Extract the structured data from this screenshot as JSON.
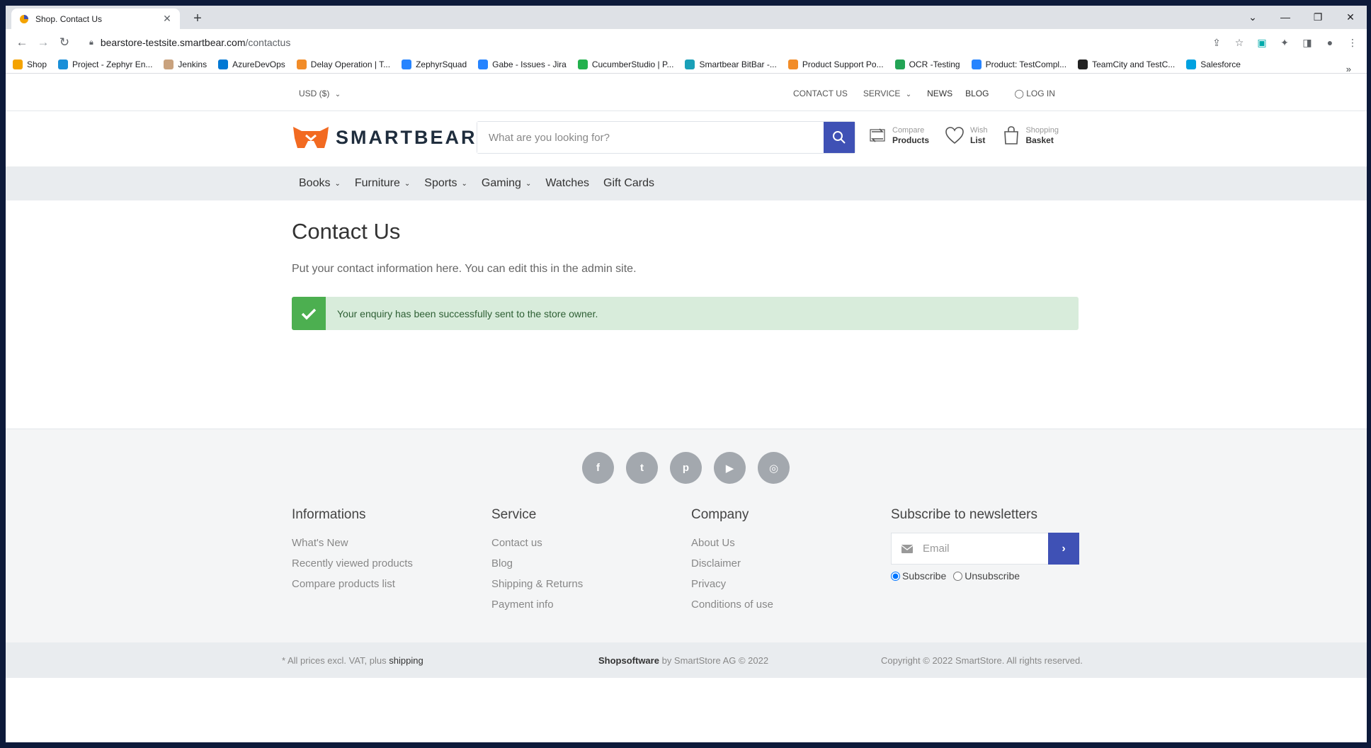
{
  "browser": {
    "tab_title": "Shop. Contact Us",
    "tab_close": "✕",
    "new_tab": "+",
    "url_host": "bearstore-testsite.smartbear.com",
    "url_path": "/contactus",
    "bookmarks": [
      {
        "label": "Shop",
        "color": "#f4a300"
      },
      {
        "label": "Project - Zephyr En...",
        "color": "#1a8fd8"
      },
      {
        "label": "Jenkins",
        "color": "#c9a27e"
      },
      {
        "label": "AzureDevOps",
        "color": "#0078d4"
      },
      {
        "label": "Delay Operation | T...",
        "color": "#f28c28"
      },
      {
        "label": "ZephyrSquad",
        "color": "#2684ff"
      },
      {
        "label": "Gabe - Issues - Jira",
        "color": "#2684ff"
      },
      {
        "label": "CucumberStudio | P...",
        "color": "#23b14d"
      },
      {
        "label": "Smartbear BitBar -...",
        "color": "#1aa0b8"
      },
      {
        "label": "Product Support Po...",
        "color": "#f28c28"
      },
      {
        "label": "OCR -Testing",
        "color": "#23a455"
      },
      {
        "label": "Product: TestCompl...",
        "color": "#2684ff"
      },
      {
        "label": "TeamCity and TestC...",
        "color": "#222222"
      },
      {
        "label": "Salesforce",
        "color": "#00a1e0"
      }
    ],
    "bookmarks_more": "»"
  },
  "topbar": {
    "currency": "USD  ($)",
    "contact": "CONTACT US",
    "service": "SERVICE",
    "news": "NEWS",
    "blog": "BLOG",
    "login": "LOG IN"
  },
  "header": {
    "logo_text": "SMARTBEAR",
    "search_placeholder": "What are you looking for?",
    "compare_small": "Compare",
    "compare_big": "Products",
    "wish_small": "Wish",
    "wish_big": "List",
    "basket_small": "Shopping",
    "basket_big": "Basket"
  },
  "categories": [
    {
      "label": "Books",
      "has_menu": true
    },
    {
      "label": "Furniture",
      "has_menu": true
    },
    {
      "label": "Sports",
      "has_menu": true
    },
    {
      "label": "Gaming",
      "has_menu": true
    },
    {
      "label": "Watches",
      "has_menu": false
    },
    {
      "label": "Gift Cards",
      "has_menu": false
    }
  ],
  "main": {
    "title": "Contact Us",
    "intro": "Put your contact information here. You can edit this in the admin site.",
    "alert": "Your enquiry has been successfully sent to the store owner."
  },
  "footer": {
    "social": [
      "f",
      "t",
      "p",
      "▶",
      "◎"
    ],
    "informations": {
      "title": "Informations",
      "links": [
        "What's New",
        "Recently viewed products",
        "Compare products list"
      ]
    },
    "service": {
      "title": "Service",
      "links": [
        "Contact us",
        "Blog",
        "Shipping & Returns",
        "Payment info"
      ]
    },
    "company": {
      "title": "Company",
      "links": [
        "About Us",
        "Disclaimer",
        "Privacy",
        "Conditions of use"
      ]
    },
    "newsletter": {
      "title": "Subscribe to newsletters",
      "email_placeholder": "Email",
      "subscribe": "Subscribe",
      "unsubscribe": "Unsubscribe"
    }
  },
  "bottombar": {
    "vat_text": "* All prices excl. VAT, plus",
    "shipping": "shipping",
    "brand": "Shopsoftware",
    "by_text": "by SmartStore AG © 2022",
    "copyright": "Copyright © 2022 SmartStore. All rights reserved."
  }
}
